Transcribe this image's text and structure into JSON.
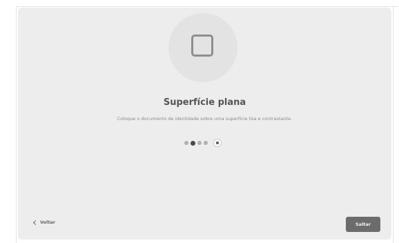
{
  "step": {
    "title": "Superfície plana",
    "description": "Coloque o documento de identidade sobre uma superfície lisa e contrastante.",
    "illustration_icon": "square-outline-icon"
  },
  "progress": {
    "total_steps": 4,
    "current_step": 2,
    "pause_icon": "pause-icon"
  },
  "footer": {
    "back_label": "Voltar",
    "back_icon": "chevron-left-icon",
    "skip_label": "Saltar"
  },
  "colors": {
    "card_background": "#ededed",
    "illustration_circle": "#e3e3e3",
    "active_dot": "#4a4a4a",
    "inactive_dot": "#b0b0b0",
    "skip_button": "#6c6c6c"
  }
}
